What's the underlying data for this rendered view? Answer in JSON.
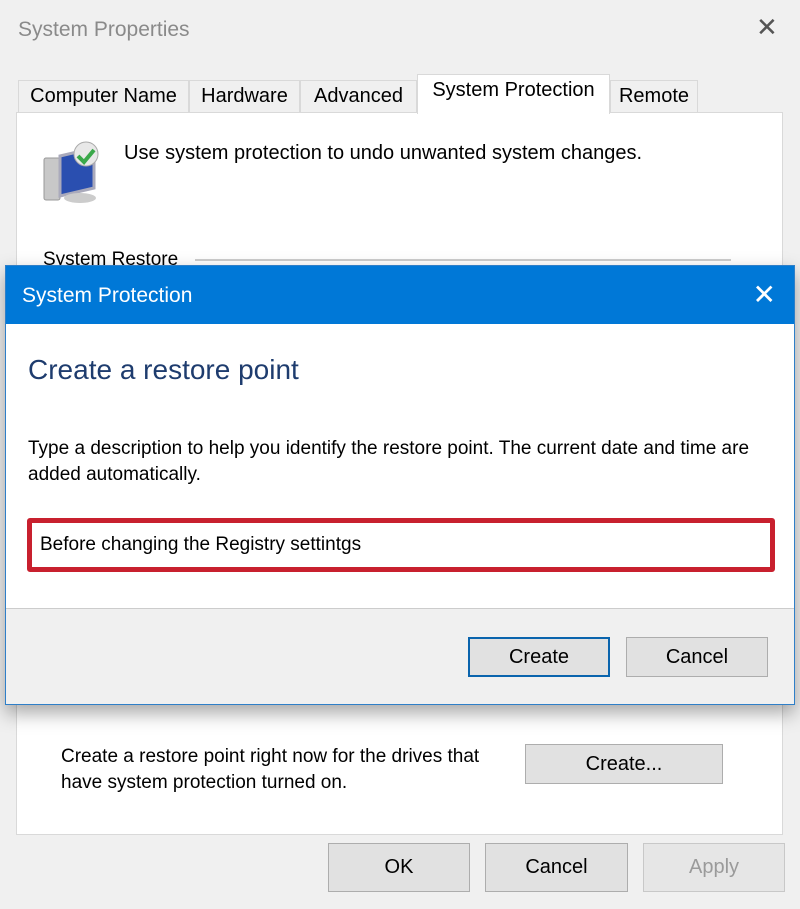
{
  "window": {
    "title": "System Properties",
    "close_icon": "close-icon"
  },
  "tabs": [
    {
      "label": "Computer Name",
      "active": false
    },
    {
      "label": "Hardware",
      "active": false
    },
    {
      "label": "Advanced",
      "active": false
    },
    {
      "label": "System Protection",
      "active": true
    },
    {
      "label": "Remote",
      "active": false
    }
  ],
  "panel": {
    "intro": "Use system protection to undo unwanted system changes.",
    "group_label": "System Restore",
    "create_text": "Create a restore point right now for the drives that have system protection turned on.",
    "create_button": "Create..."
  },
  "footer": {
    "ok": "OK",
    "cancel": "Cancel",
    "apply": "Apply"
  },
  "dialog": {
    "title": "System Protection",
    "heading": "Create a restore point",
    "description": "Type a description to help you identify the restore point. The current date and time are added automatically.",
    "input_value": "Before changing the Registry settintgs",
    "create": "Create",
    "cancel": "Cancel",
    "accent_color": "#0078d7",
    "highlight_color": "#c8202e"
  }
}
